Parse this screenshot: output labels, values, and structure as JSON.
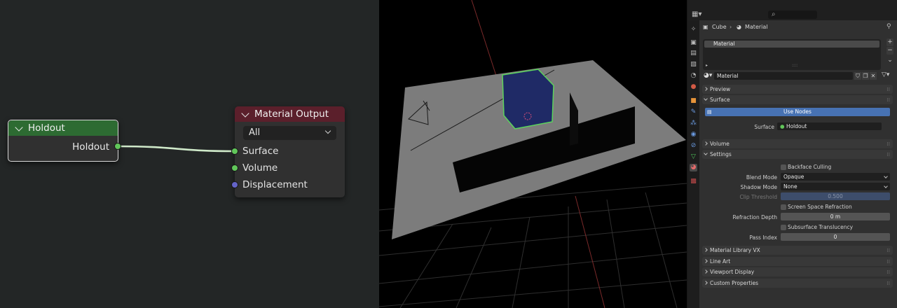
{
  "node_editor": {
    "holdout_node": {
      "title": "Holdout",
      "output_socket": "Holdout"
    },
    "material_output_node": {
      "title": "Material Output",
      "target": "All",
      "inputs": [
        "Surface",
        "Volume",
        "Displacement"
      ]
    },
    "colors": {
      "holdout_header": "#2d6b32",
      "output_header": "#5b1f2b",
      "shader_socket": "#61c65a",
      "vector_socket": "#6464c8"
    }
  },
  "properties": {
    "breadcrumb": {
      "object": "Cube",
      "material": "Material"
    },
    "material_slots": [
      "Material"
    ],
    "slot_dots": "::::",
    "material_name": "Material",
    "sections": {
      "preview": "Preview",
      "surface": "Surface",
      "volume": "Volume",
      "settings": "Settings",
      "material_library": "Material Library VX",
      "line_art": "Line Art",
      "viewport_display": "Viewport Display",
      "custom_properties": "Custom Properties"
    },
    "surface": {
      "use_nodes_label": "Use Nodes",
      "surface_label": "Surface",
      "surface_value": "Holdout"
    },
    "settings": {
      "backface_culling": "Backface Culling",
      "blend_mode_label": "Blend Mode",
      "blend_mode_value": "Opaque",
      "shadow_mode_label": "Shadow Mode",
      "shadow_mode_value": "None",
      "clip_threshold_label": "Clip Threshold",
      "clip_threshold_value": "0.500",
      "screen_space_refraction": "Screen Space Refraction",
      "refraction_depth_label": "Refraction Depth",
      "refraction_depth_value": "0 m",
      "subsurface_translucency": "Subsurface Translucency",
      "pass_index_label": "Pass Index",
      "pass_index_value": "0"
    },
    "colors": {
      "accent_blue": "#4772b3",
      "selection_outline": "#5bd45b"
    }
  }
}
